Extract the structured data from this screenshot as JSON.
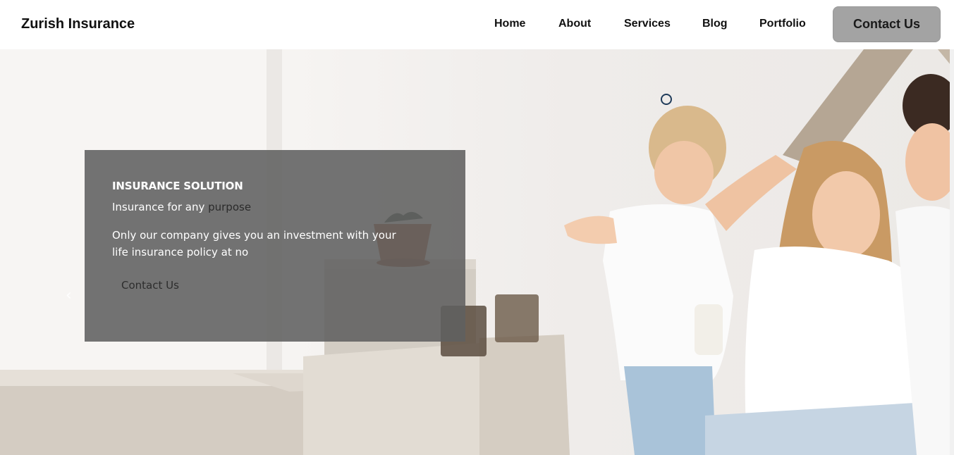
{
  "brand": {
    "name": "Zurish Insurance"
  },
  "nav": {
    "links": [
      "Home",
      "About",
      "Services",
      "Blog",
      "Portfolio"
    ],
    "cta": "Contact Us"
  },
  "hero": {
    "title": "INSURANCE SOLUTION",
    "subtitle_prefix": "Insurance for any ",
    "subtitle_accent": "purpose",
    "body": "Only our company gives you an investment with your life insurance policy at no",
    "button": "Contact Us",
    "prev_icon": "chevron-left-icon",
    "next_icon": "chevron-right-icon"
  },
  "colors": {
    "cta_bg": "#a3a3a3",
    "overlay_bg": "#606060",
    "dot_border": "#1f3b5a"
  }
}
